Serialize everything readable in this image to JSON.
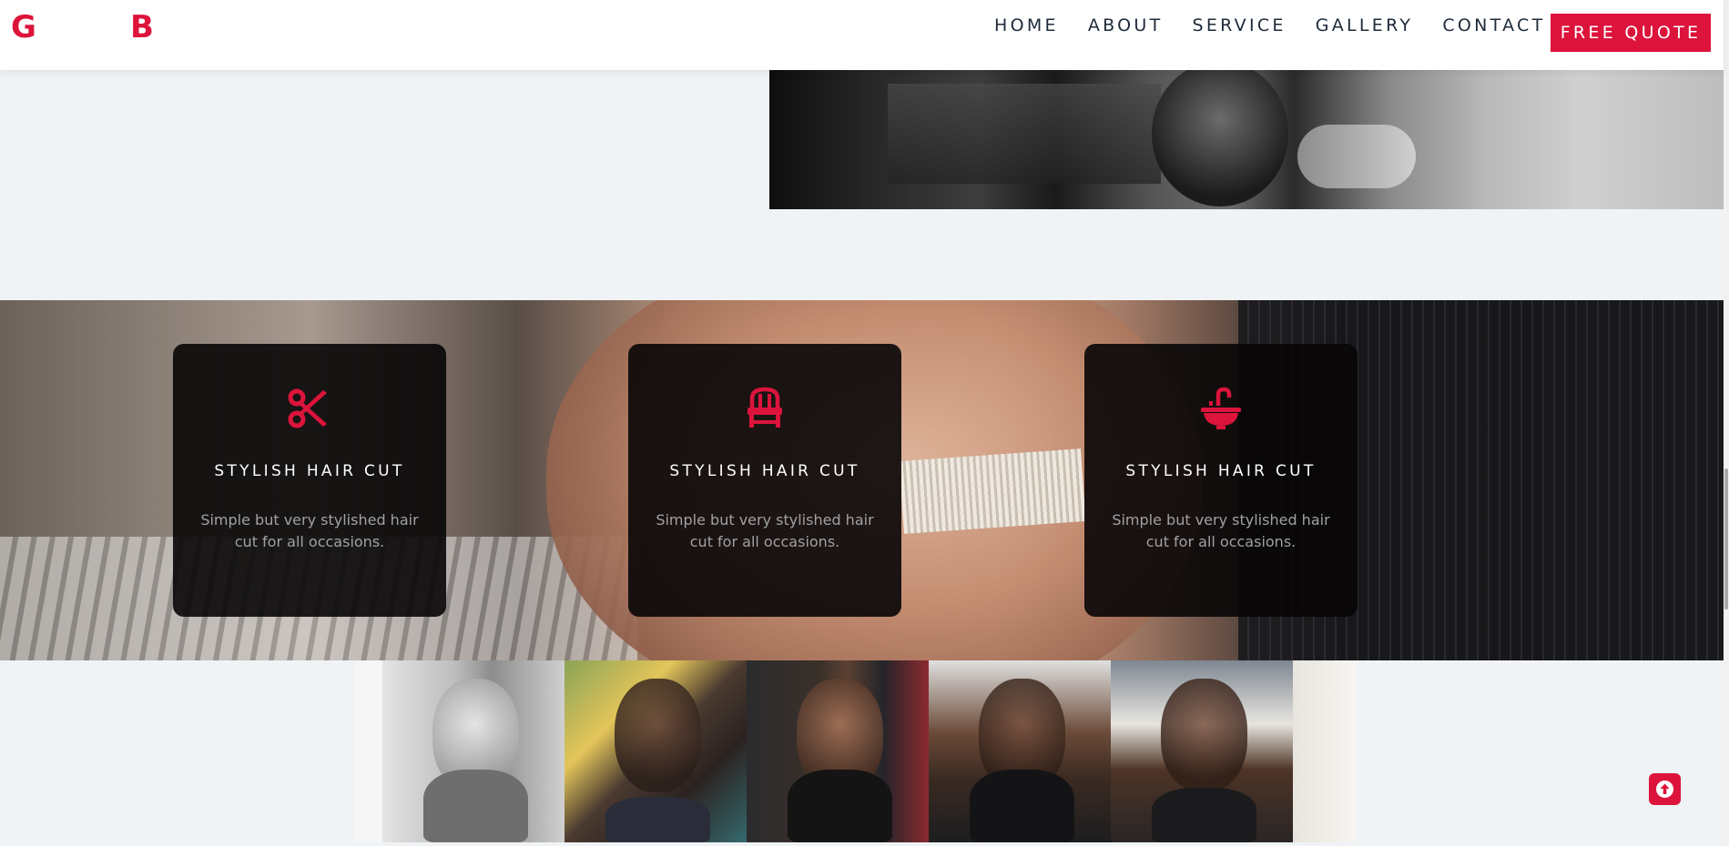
{
  "brand": {
    "logo_left": "G",
    "logo_right": "B",
    "accent_color": "#dc143c"
  },
  "nav": {
    "items": [
      {
        "label": "HOME"
      },
      {
        "label": "ABOUT"
      },
      {
        "label": "SERVICE"
      },
      {
        "label": "GALLERY"
      },
      {
        "label": "CONTACT"
      }
    ],
    "cta_label": "FREE QUOTE"
  },
  "services": [
    {
      "icon": "scissors-icon",
      "title": "STYLISH HAIR CUT",
      "description": "Simple but very stylished hair cut for all occasions."
    },
    {
      "icon": "barber-chair-icon",
      "title": "STYLISH HAIR CUT",
      "description": "Simple but very stylished hair cut for all occasions."
    },
    {
      "icon": "wash-basin-icon",
      "title": "STYLISH HAIR CUT",
      "description": "Simple but very stylished hair cut for all occasions."
    }
  ],
  "back_to_top": {
    "icon": "arrow-up-icon"
  }
}
